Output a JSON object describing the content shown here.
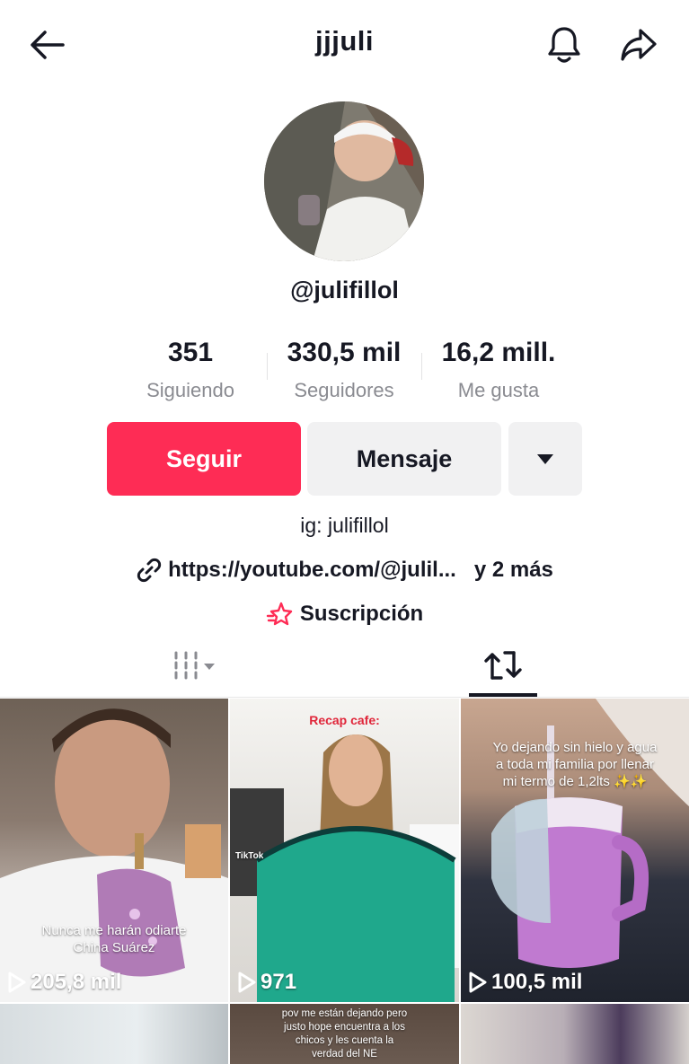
{
  "header": {
    "username": "jjjuli",
    "back_icon": "arrow-left-icon",
    "bell_icon": "bell-icon",
    "share_icon": "share-icon"
  },
  "profile": {
    "handle": "@julifillol",
    "stats": [
      {
        "value": "351",
        "label": "Siguiendo"
      },
      {
        "value": "330,5 mil",
        "label": "Seguidores"
      },
      {
        "value": "16,2 mill.",
        "label": "Me gusta"
      }
    ],
    "buttons": {
      "follow": "Seguir",
      "message": "Mensaje",
      "more_icon": "caret-down-icon"
    },
    "bio": "ig: julifillol",
    "link": {
      "url": "https://youtube.com/@julil...",
      "more": "y 2 más"
    },
    "subscription": "Suscripción"
  },
  "colors": {
    "accent": "#fe2c55",
    "secondary_button": "#f1f1f2"
  },
  "tabs": [
    {
      "icon": "grid-icon",
      "active": false
    },
    {
      "icon": "repost-icon",
      "active": true
    }
  ],
  "videos": [
    {
      "caption": "Nunca me harán odiarte\nChina Suárez",
      "views": "205,8 mil"
    },
    {
      "caption": "Recap cafe:",
      "views": "971",
      "watermark": "TikTok"
    },
    {
      "caption": "Yo dejando sin hielo y agua\na toda mi familia por llenar\nmi termo de 1,2lts ✨✨",
      "views": "100,5 mil"
    },
    {
      "caption": "",
      "views": ""
    },
    {
      "caption": "pov me están dejando pero\njusto hope encuentra a los\nchicos y les cuenta la\nverdad del NE",
      "views": ""
    },
    {
      "caption": "",
      "views": ""
    }
  ]
}
